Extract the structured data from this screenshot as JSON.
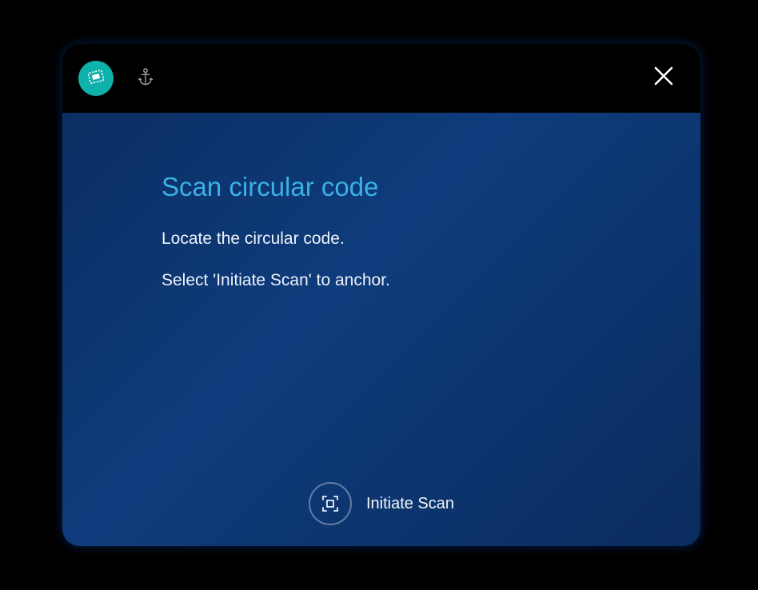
{
  "header": {
    "tabs": [
      {
        "name": "scan-tab",
        "icon": "chip-icon",
        "active": true
      },
      {
        "name": "anchor-tab",
        "icon": "anchor-icon",
        "active": false
      }
    ],
    "close_label": "Close"
  },
  "main": {
    "title": "Scan circular code",
    "instructions": [
      "Locate the circular code.",
      "Select 'Initiate Scan' to anchor."
    ]
  },
  "action": {
    "primary_label": "Initiate Scan"
  }
}
